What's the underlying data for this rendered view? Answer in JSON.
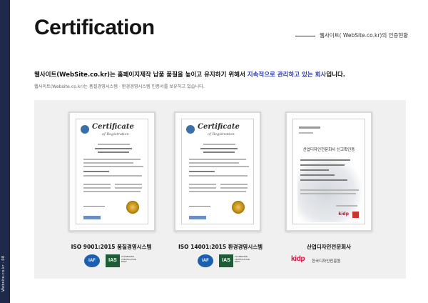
{
  "page": {
    "title": "Certification",
    "subtitle": "웹사이트( WebSite.co.kr)의 인증현황",
    "sidebar_text": "Website.co.kr · 08"
  },
  "intro": {
    "headline_part1": "웹사이트(WebSite.co.kr)는 홈페이지제작 납품 품질을 높이고 유지하기 위해서 ",
    "headline_highlight": "지속적으로 관리하고 있는 회사",
    "headline_part2": "입니다.",
    "description": "웹사이트(Website.co.kr)는 품질경영시스템 · 환경경영시스템 인증서를 보유하고 있습니다."
  },
  "certificates": [
    {
      "caption": "ISO 9001:2015 품질경영시스템",
      "doc_title": "Certificate",
      "doc_subtitle": "of Registration",
      "logos": [
        "IAF",
        "IAS"
      ],
      "ias_note": "ACCREDITED CERTIFICATION BODY"
    },
    {
      "caption": "ISO 14001:2015 환경경영시스템",
      "doc_title": "Certificate",
      "doc_subtitle": "of Registration",
      "logos": [
        "IAF",
        "IAS"
      ],
      "ias_note": "ACCREDITED CERTIFICATION BODY"
    },
    {
      "caption": "산업디자인전문회사",
      "doc_title": "산업디자인전문회사 신고확인증",
      "issuer_logo": "kidp",
      "issuer_name": "한국디자인진흥원"
    }
  ],
  "colors": {
    "sidebar": "#1f2a4a",
    "highlight": "#2f3fa8",
    "kidp_red": "#d0103a",
    "iaf_blue": "#1c5fae",
    "ias_green": "#1d5c34"
  }
}
